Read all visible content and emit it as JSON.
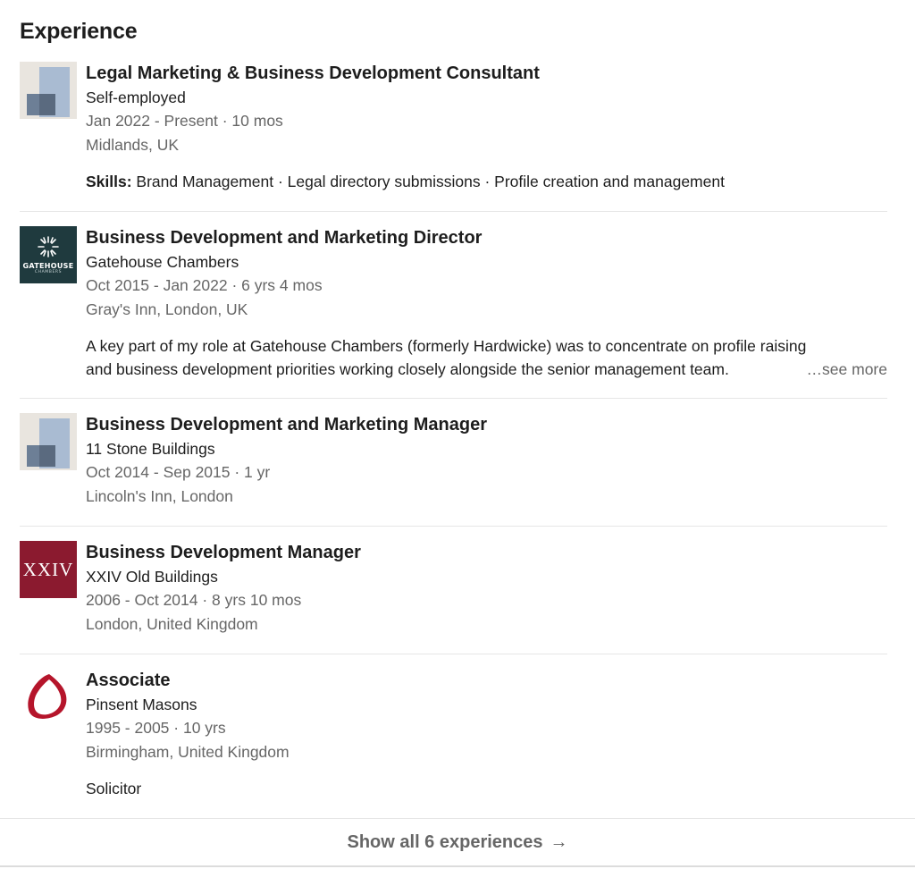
{
  "section": {
    "title": "Experience"
  },
  "experiences": [
    {
      "title": "Legal Marketing & Business Development Consultant",
      "company": "Self-employed",
      "dates": "Jan 2022 - Present · 10 mos",
      "location": "Midlands, UK",
      "skills_label": "Skills:",
      "skills": " Brand Management · Legal directory submissions · Profile creation and management",
      "logo": "placeholder-building-icon"
    },
    {
      "title": "Business Development and Marketing Director",
      "company": "Gatehouse Chambers",
      "dates": "Oct 2015 - Jan 2022 · 6 yrs 4 mos",
      "location": "Gray's Inn, London, UK",
      "description_line1": "A key part of my role at Gatehouse Chambers (formerly Hardwicke) was to concentrate on profile raising",
      "description_line2": "and business development priorities working closely alongside the senior management team.",
      "see_more": "…see more",
      "logo": "gatehouse-logo",
      "logo_text": "GATEHOUSE",
      "logo_subtext": "CHAMBERS"
    },
    {
      "title": "Business Development and Marketing Manager",
      "company": "11 Stone Buildings",
      "dates": "Oct 2014 - Sep 2015 · 1 yr",
      "location": "Lincoln's Inn, London",
      "logo": "placeholder-building-icon"
    },
    {
      "title": "Business Development Manager",
      "company": "XXIV Old Buildings",
      "dates": "2006 - Oct 2014 · 8 yrs 10 mos",
      "location": "London, United Kingdom",
      "logo": "xxiv-logo",
      "logo_text": "XXIV"
    },
    {
      "title": "Associate",
      "company": "Pinsent Masons",
      "dates": "1995 - 2005 · 10 yrs",
      "location": "Birmingham, United Kingdom",
      "description": "Solicitor",
      "logo": "pinsent-masons-logo"
    }
  ],
  "footer": {
    "show_all_label": "Show all 6 experiences",
    "arrow": "→"
  },
  "colors": {
    "gatehouse_bg": "#1f3a3e",
    "xxiv_bg": "#8b1a2f",
    "pinsent_red": "#b5152b",
    "muted_text": "#666666"
  }
}
